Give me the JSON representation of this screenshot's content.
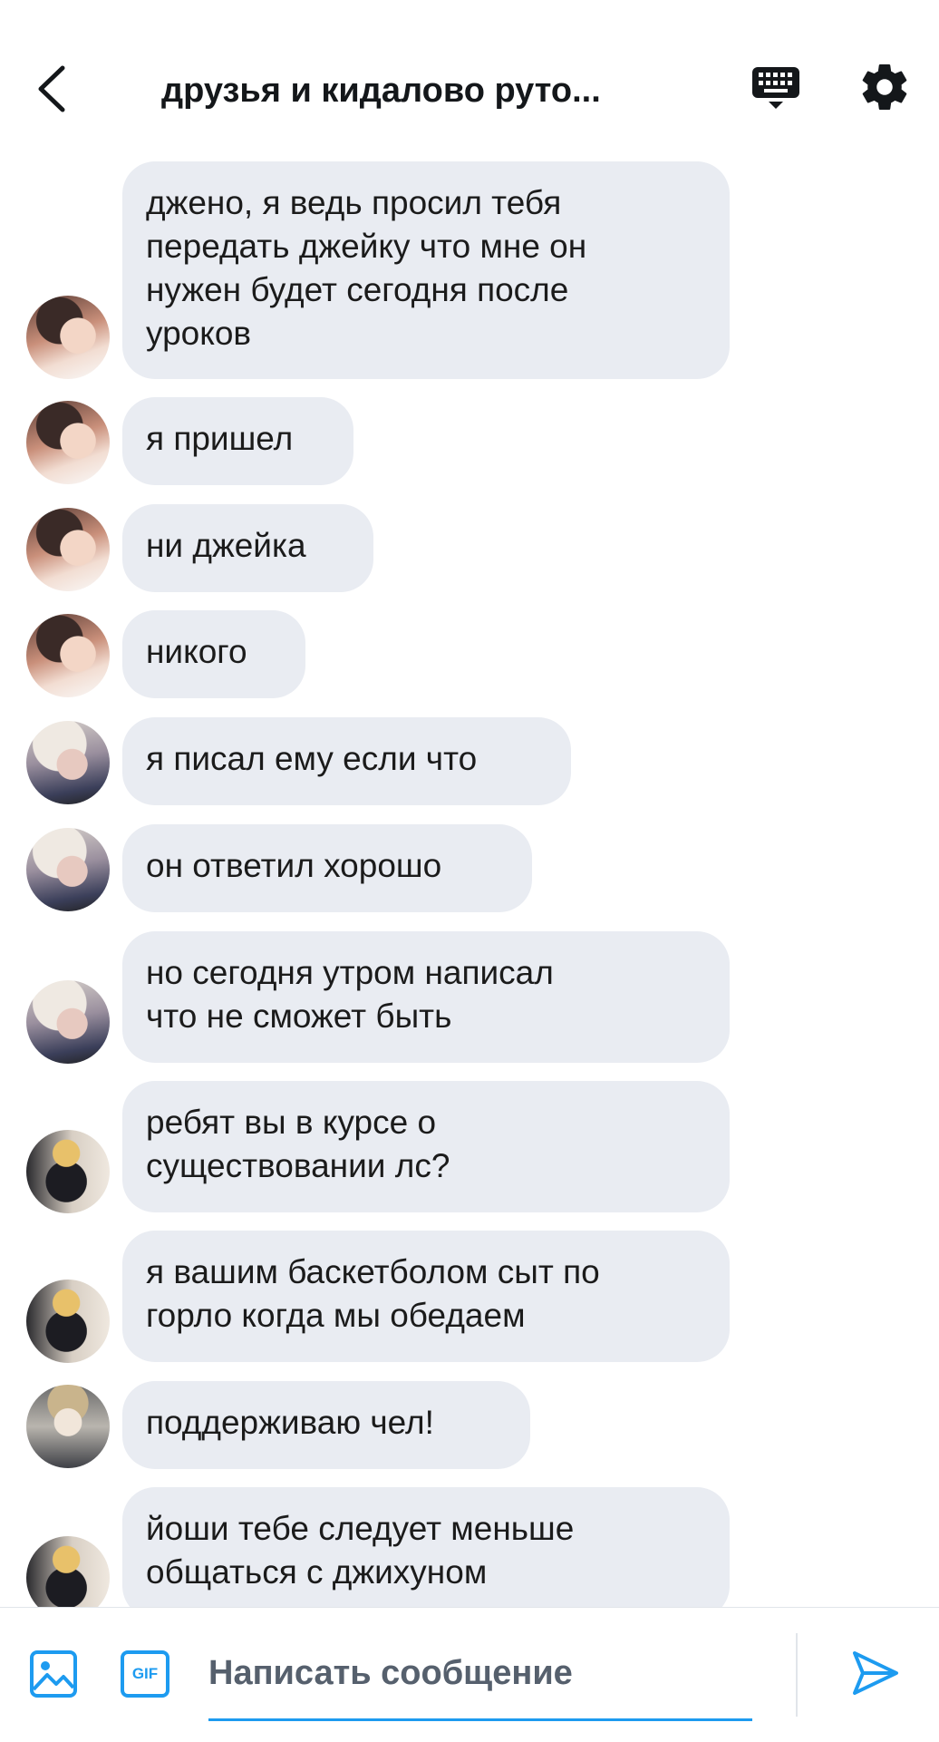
{
  "header": {
    "title": "друзья и кидалово руто..."
  },
  "messages": [
    {
      "text": "джено, я ведь просил тебя\nпередать джейку что мне он\nнужен будет сегодня после\nуроков"
    },
    {
      "text": "я пришел"
    },
    {
      "text": "ни джейка"
    },
    {
      "text": "никого"
    },
    {
      "text": "я писал ему если что"
    },
    {
      "text": "он ответил хорошо"
    },
    {
      "text": "но сегодня утром написал\nчто не сможет быть"
    },
    {
      "text": "ребят вы в курсе о\nсуществовании лс?"
    },
    {
      "text": "я вашим баскетболом сыт по\nгорло когда мы обедаем"
    },
    {
      "text": "поддерживаю чел!"
    },
    {
      "text": "йоши тебе следует меньше\nобщаться с джихуном"
    }
  ],
  "composer": {
    "placeholder": "Написать сообщение",
    "gif_label": "GIF"
  },
  "colors": {
    "accent": "#1d9bf0",
    "bubble": "#e9ecf2"
  }
}
